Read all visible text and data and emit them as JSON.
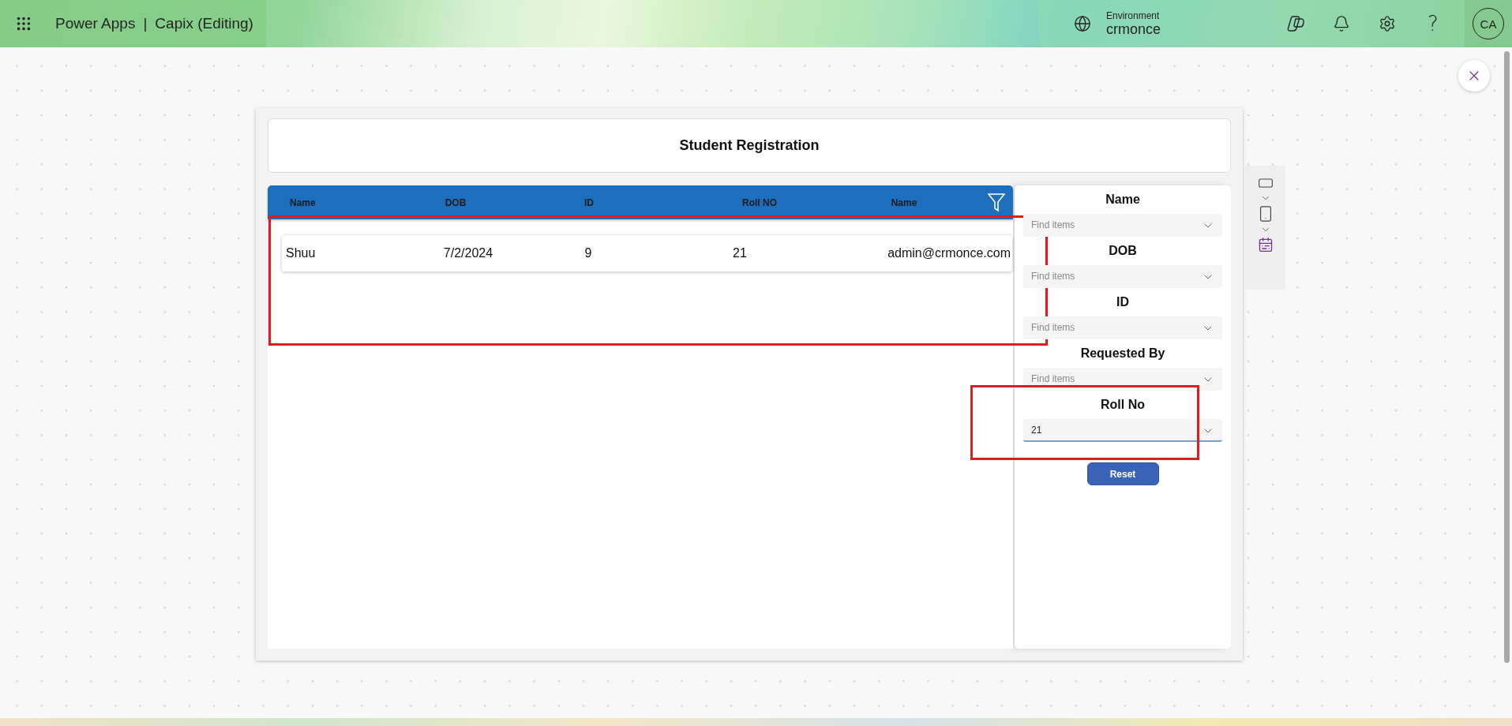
{
  "top_bar": {
    "product": "Power Apps",
    "separator": "|",
    "app_name": "Capix (Editing)",
    "environment_label": "Environment",
    "environment_name": "crmonce",
    "help": "?",
    "avatar": "CA"
  },
  "screen": {
    "title": "Student Registration",
    "grid": {
      "highlighted": true,
      "columns": [
        "Name",
        "DOB",
        "ID",
        "Roll NO",
        "Name"
      ],
      "rows": [
        {
          "cells": [
            "Shuu",
            "7/2/2024",
            "9",
            "21",
            "admin@crmonce.com"
          ]
        }
      ]
    },
    "filters": [
      {
        "label": "Name",
        "placeholder": "Find items",
        "focused": false,
        "highlighted": false
      },
      {
        "label": "DOB",
        "placeholder": "Find items",
        "focused": false,
        "highlighted": false
      },
      {
        "label": "ID",
        "placeholder": "Find items",
        "focused": false,
        "highlighted": false
      },
      {
        "label": "Requested By",
        "placeholder": "Find items",
        "focused": false,
        "highlighted": false
      },
      {
        "label": "Roll No",
        "value": "21",
        "focused": true,
        "highlighted": true
      }
    ],
    "reset_button": "Reset"
  }
}
